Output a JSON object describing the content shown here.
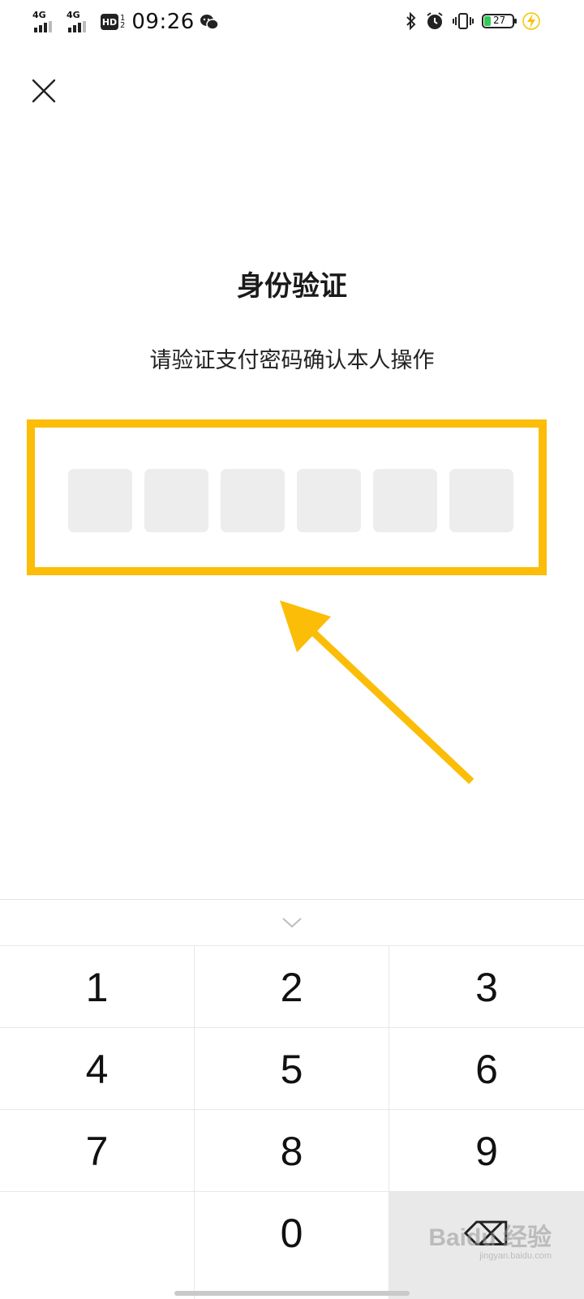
{
  "status_bar": {
    "net1": "4G",
    "net2": "4G",
    "hd": "HD",
    "hd_sub_top": "1",
    "hd_sub_bottom": "2",
    "time": "09:26",
    "battery": "27"
  },
  "page": {
    "title": "身份验证",
    "subtitle": "请验证支付密码确认本人操作"
  },
  "pin": {
    "length": 6,
    "filled": 0
  },
  "keypad": {
    "keys": [
      "1",
      "2",
      "3",
      "4",
      "5",
      "6",
      "7",
      "8",
      "9",
      "",
      "0",
      "⌫"
    ]
  },
  "watermark": {
    "text": "Baidu 经验",
    "sub": "jingyan.baidu.com"
  },
  "colors": {
    "highlight": "#fbbd08",
    "pin_cell": "#ededed",
    "battery_fill": "#34c759",
    "charging": "#f5c400"
  },
  "icons": {
    "close": "close-icon",
    "collapse": "chevron-down-icon",
    "bluetooth": "bluetooth-icon",
    "alarm": "alarm-icon",
    "vibrate": "vibrate-icon",
    "charging": "lightning-icon",
    "wechat": "wechat-icon"
  }
}
